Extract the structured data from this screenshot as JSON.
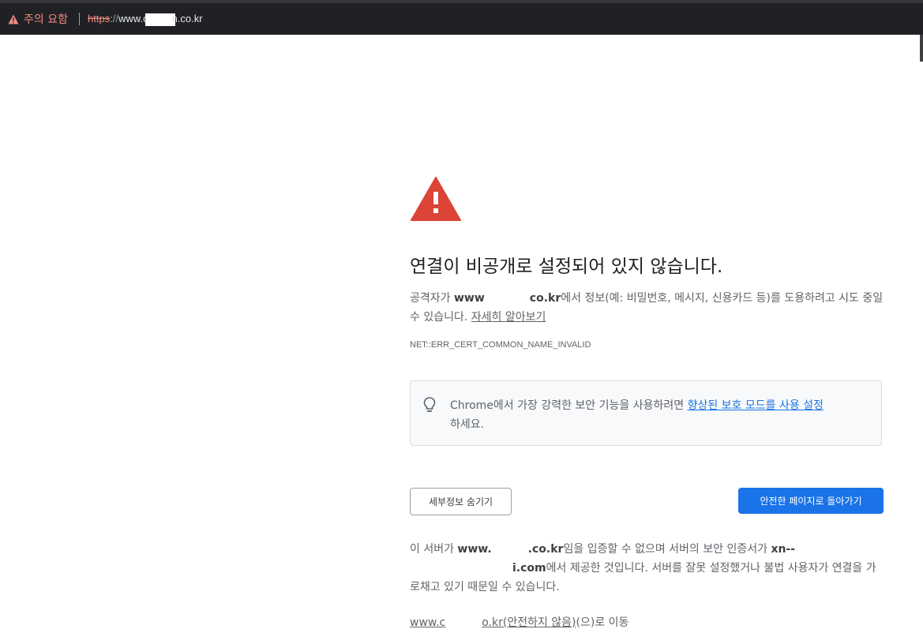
{
  "browser": {
    "security_chip": "주의 요함",
    "url_scheme": "https",
    "url_separator": "://",
    "url_host_prefix": "www.c",
    "url_host_suffix": "n.co.kr"
  },
  "page": {
    "heading": "연결이 비공개로 설정되어 있지 않습니다.",
    "intro_before": "공격자가 ",
    "intro_host_a": "www",
    "intro_host_b": "co.kr",
    "intro_after": "에서 정보(예: 비밀번호, 메시지, 신용카드 등)를 도용하려고 시도 중일 수 있습니다. ",
    "learn_more": "자세히 알아보기",
    "error_code": "NET::ERR_CERT_COMMON_NAME_INVALID",
    "promo_before": "Chrome에서 가장 강력한 보안 기능을 사용하려면 ",
    "promo_link": "향상된 보호 모드를 사용 설정",
    "promo_after": "하세요.",
    "hide_details_button": "세부정보 숨기기",
    "back_to_safety_button": "안전한 페이지로 돌아가기",
    "details_before": "이 서버가 ",
    "details_host_a": "www.",
    "details_host_b": ".co.kr",
    "details_mid": "임을 입증할 수 없으며 서버의 보안 인증서가 ",
    "details_cert_a": "xn--",
    "details_cert_b": "i.com",
    "details_after": "에서 제공한 것입니다. 서버를 잘못 설정했거나 불법 사용자가 연결을 가로채고 있기 때문일 수 있습니다.",
    "proceed_link_a": "www.c",
    "proceed_link_b": "o.kr(안전하지 않음)",
    "proceed_tail": "(으)로 이동"
  },
  "colors": {
    "warning_red": "#db4437",
    "link_blue": "#1a73e8",
    "chip_red": "#f28b82"
  },
  "icons": [
    "warning-triangle-icon",
    "lightbulb-icon",
    "warning-icon"
  ]
}
